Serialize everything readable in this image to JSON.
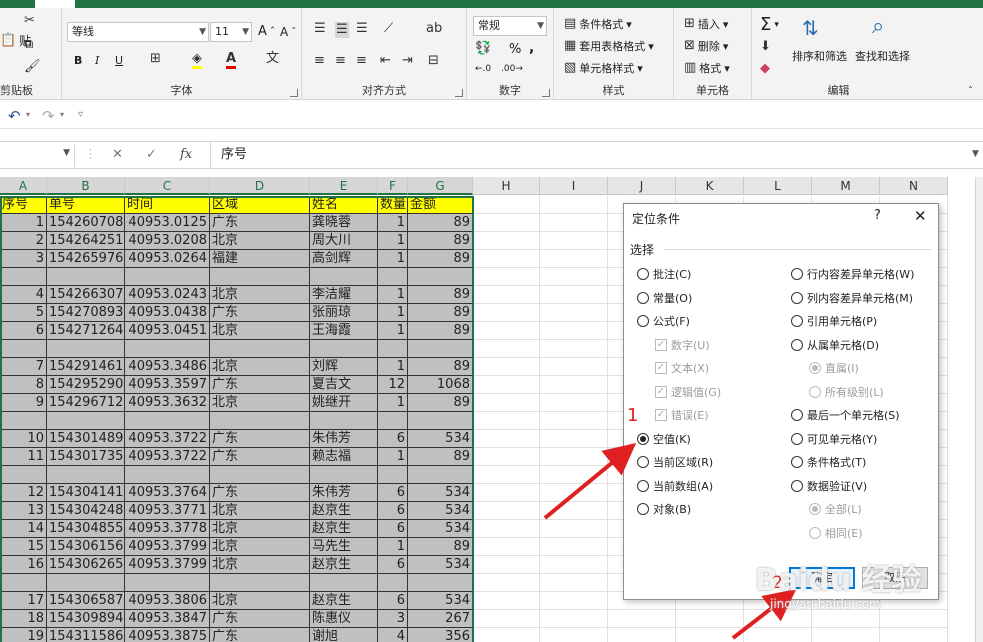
{
  "ribbon": {
    "clipboard": {
      "paste": "贴",
      "label": "剪贴板"
    },
    "font": {
      "name": "等线",
      "size": "11",
      "bold": "B",
      "italic": "I",
      "underline": "U",
      "label": "字体"
    },
    "alignment": {
      "label": "对齐方式"
    },
    "number": {
      "format": "常规",
      "percent": "%",
      "comma": ",",
      "label": "数字"
    },
    "styles": {
      "conditional": "条件格式",
      "table": "套用表格格式",
      "cell": "单元格样式",
      "label": "样式"
    },
    "cells": {
      "insert": "插入",
      "delete": "删除",
      "format": "格式",
      "label": "单元格"
    },
    "editing": {
      "sort": "排序和筛选",
      "find": "查找和选择",
      "label": "编辑"
    }
  },
  "formula_bar": {
    "fx": "fx",
    "content": "序号"
  },
  "columns": [
    "A",
    "B",
    "C",
    "D",
    "E",
    "F",
    "G",
    "H",
    "I",
    "J",
    "K",
    "L",
    "M",
    "N"
  ],
  "header_row": [
    "序号",
    "单号",
    "时间",
    "区域",
    "姓名",
    "数量",
    "金额"
  ],
  "rows": [
    [
      "1",
      "154260708",
      "40953.0125",
      "广东",
      "龚晓蓉",
      "1",
      "89"
    ],
    [
      "2",
      "154264251",
      "40953.0208",
      "北京",
      "周大川",
      "1",
      "89"
    ],
    [
      "3",
      "154265976",
      "40953.0264",
      "福建",
      "高剑辉",
      "1",
      "89"
    ],
    [
      "",
      "",
      "",
      "",
      "",
      "",
      ""
    ],
    [
      "4",
      "154266307",
      "40953.0243",
      "北京",
      "李洁耀",
      "1",
      "89"
    ],
    [
      "5",
      "154270893",
      "40953.0438",
      "广东",
      "张丽琼",
      "1",
      "89"
    ],
    [
      "6",
      "154271264",
      "40953.0451",
      "北京",
      "王海霞",
      "1",
      "89"
    ],
    [
      "",
      "",
      "",
      "",
      "",
      "",
      ""
    ],
    [
      "7",
      "154291461",
      "40953.3486",
      "北京",
      "刘辉",
      "1",
      "89"
    ],
    [
      "8",
      "154295290",
      "40953.3597",
      "广东",
      "夏吉文",
      "12",
      "1068"
    ],
    [
      "9",
      "154296712",
      "40953.3632",
      "北京",
      "姚继开",
      "1",
      "89"
    ],
    [
      "",
      "",
      "",
      "",
      "",
      "",
      ""
    ],
    [
      "10",
      "154301489",
      "40953.3722",
      "广东",
      "朱伟芳",
      "6",
      "534"
    ],
    [
      "11",
      "154301735",
      "40953.3722",
      "广东",
      "赖志福",
      "1",
      "89"
    ],
    [
      "",
      "",
      "",
      "",
      "",
      "",
      ""
    ],
    [
      "12",
      "154304141",
      "40953.3764",
      "广东",
      "朱伟芳",
      "6",
      "534"
    ],
    [
      "13",
      "154304248",
      "40953.3771",
      "北京",
      "赵京生",
      "6",
      "534"
    ],
    [
      "14",
      "154304855",
      "40953.3778",
      "北京",
      "赵京生",
      "6",
      "534"
    ],
    [
      "15",
      "154306156",
      "40953.3799",
      "北京",
      "马先生",
      "1",
      "89"
    ],
    [
      "16",
      "154306265",
      "40953.3799",
      "北京",
      "赵京生",
      "6",
      "534"
    ],
    [
      "",
      "",
      "",
      "",
      "",
      "",
      ""
    ],
    [
      "17",
      "154306587",
      "40953.3806",
      "北京",
      "赵京生",
      "6",
      "534"
    ],
    [
      "18",
      "154309894",
      "40953.3847",
      "广东",
      "陈惠仪",
      "3",
      "267"
    ],
    [
      "19",
      "154311586",
      "40953.3875",
      "广东",
      "谢旭",
      "4",
      "356"
    ]
  ],
  "dialog": {
    "title": "定位条件",
    "help": "?",
    "close": "✕",
    "section": "选择",
    "left_options": [
      {
        "label": "批注(C)",
        "state": "off"
      },
      {
        "label": "常量(O)",
        "state": "off"
      },
      {
        "label": "公式(F)",
        "state": "off"
      },
      {
        "label": "数字(U)",
        "state": "chk"
      },
      {
        "label": "文本(X)",
        "state": "chk"
      },
      {
        "label": "逻辑值(G)",
        "state": "chk"
      },
      {
        "label": "错误(E)",
        "state": "chk"
      },
      {
        "label": "空值(K)",
        "state": "on"
      },
      {
        "label": "当前区域(R)",
        "state": "off"
      },
      {
        "label": "当前数组(A)",
        "state": "off"
      },
      {
        "label": "对象(B)",
        "state": "off"
      }
    ],
    "right_options": [
      {
        "label": "行内容差异单元格(W)",
        "state": "off"
      },
      {
        "label": "列内容差异单元格(M)",
        "state": "off"
      },
      {
        "label": "引用单元格(P)",
        "state": "off"
      },
      {
        "label": "从属单元格(D)",
        "state": "off"
      },
      {
        "label": "直属(I)",
        "state": "dis-on"
      },
      {
        "label": "所有级别(L)",
        "state": "dis"
      },
      {
        "label": "最后一个单元格(S)",
        "state": "off"
      },
      {
        "label": "可见单元格(Y)",
        "state": "off"
      },
      {
        "label": "条件格式(T)",
        "state": "off"
      },
      {
        "label": "数据验证(V)",
        "state": "off"
      },
      {
        "label": "全部(L)",
        "state": "dis-on"
      },
      {
        "label": "相同(E)",
        "state": "dis"
      }
    ],
    "ok": "确定",
    "cancel": "取消"
  },
  "annotations": {
    "step1": "1",
    "step2": "2"
  },
  "watermark": {
    "brand": "Baidu 经验",
    "url": "jingyan.baidu.com"
  },
  "colors": {
    "excel_green": "#217346",
    "header_yellow": "#ffff00",
    "row_gray": "#c0c0c0",
    "annot_red": "#e02020"
  }
}
